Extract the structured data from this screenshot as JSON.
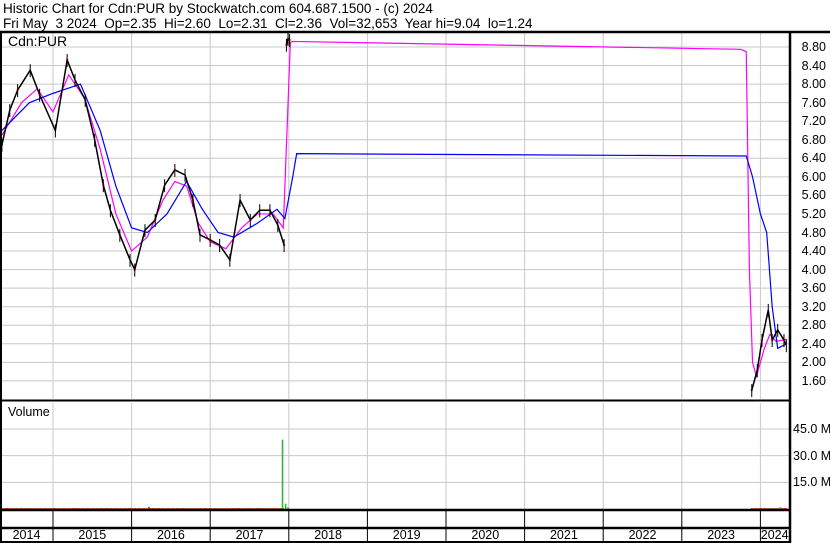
{
  "header": {
    "title": "Historic Chart for Cdn:PUR by Stockwatch.com 604.687.1500 - (c) 2024",
    "quote_line": "Fri May  3 2024  Op=2.35  Hi=2.60  Lo=2.31  Cl=2.36  Vol=32,653  Year hi=9.04  lo=1.24"
  },
  "price_panel": {
    "symbol_label": "Cdn:PUR"
  },
  "volume_panel": {
    "label": "Volume"
  },
  "colors": {
    "price": "#000000",
    "price_dots": "#ff0000",
    "ma_short": "#ff00ff",
    "ma_long": "#0000ff",
    "vol_up": "#3cb043",
    "vol_down": "#ff0000",
    "grid": "#c8c8c8"
  },
  "chart_data": [
    {
      "type": "line",
      "title": "Cdn:PUR",
      "ylim": [
        1.2,
        9.1
      ],
      "y_ticks": [
        "8.80",
        "8.40",
        "8.00",
        "7.60",
        "7.20",
        "6.80",
        "6.40",
        "6.00",
        "5.60",
        "5.20",
        "4.80",
        "4.40",
        "4.00",
        "3.60",
        "3.20",
        "2.80",
        "2.40",
        "2.00",
        "1.60"
      ],
      "x_ticks": [
        "2014",
        "2015",
        "2016",
        "2017",
        "2018",
        "2019",
        "2020",
        "2021",
        "2022",
        "2023",
        "2024"
      ],
      "series": [
        {
          "name": "price",
          "points": [
            [
              2014.35,
              6.69
            ],
            [
              2014.45,
              7.44
            ],
            [
              2014.55,
              7.87
            ],
            [
              2014.71,
              8.3
            ],
            [
              2014.83,
              7.77
            ],
            [
              2015.03,
              7.0
            ],
            [
              2015.18,
              8.52
            ],
            [
              2015.28,
              8.09
            ],
            [
              2015.41,
              7.66
            ],
            [
              2015.53,
              6.8
            ],
            [
              2015.64,
              5.82
            ],
            [
              2015.73,
              5.28
            ],
            [
              2015.85,
              4.75
            ],
            [
              2015.98,
              4.21
            ],
            [
              2016.04,
              4.0
            ],
            [
              2016.17,
              4.85
            ],
            [
              2016.3,
              5.07
            ],
            [
              2016.42,
              5.82
            ],
            [
              2016.55,
              6.15
            ],
            [
              2016.68,
              6.04
            ],
            [
              2016.78,
              5.5
            ],
            [
              2016.87,
              4.75
            ],
            [
              2017.0,
              4.64
            ],
            [
              2017.12,
              4.53
            ],
            [
              2017.25,
              4.21
            ],
            [
              2017.38,
              5.5
            ],
            [
              2017.51,
              5.07
            ],
            [
              2017.63,
              5.28
            ],
            [
              2017.76,
              5.28
            ],
            [
              2017.86,
              4.96
            ],
            [
              2017.94,
              4.53
            ]
          ],
          "segment2": [
            [
              2017.97,
              8.85
            ],
            [
              2017.99,
              8.98
            ],
            [
              2018.01,
              8.95
            ]
          ],
          "segment3": [
            [
              2023.89,
              1.4
            ],
            [
              2023.96,
              1.83
            ],
            [
              2024.02,
              2.48
            ],
            [
              2024.1,
              3.13
            ],
            [
              2024.15,
              2.48
            ],
            [
              2024.22,
              2.7
            ],
            [
              2024.3,
              2.48
            ],
            [
              2024.33,
              2.37
            ]
          ]
        },
        {
          "name": "ma_short",
          "points": [
            [
              2014.35,
              6.9
            ],
            [
              2014.6,
              7.6
            ],
            [
              2014.8,
              7.9
            ],
            [
              2015.0,
              7.4
            ],
            [
              2015.2,
              8.2
            ],
            [
              2015.4,
              7.7
            ],
            [
              2015.6,
              6.6
            ],
            [
              2015.8,
              5.2
            ],
            [
              2016.0,
              4.4
            ],
            [
              2016.2,
              4.7
            ],
            [
              2016.4,
              5.5
            ],
            [
              2016.55,
              5.9
            ],
            [
              2016.7,
              5.8
            ],
            [
              2016.85,
              5.0
            ],
            [
              2017.0,
              4.6
            ],
            [
              2017.2,
              4.45
            ],
            [
              2017.4,
              4.9
            ],
            [
              2017.6,
              5.2
            ],
            [
              2017.8,
              5.2
            ],
            [
              2017.93,
              4.9
            ],
            [
              2018.02,
              8.9
            ],
            [
              2018.05,
              8.92
            ],
            [
              2023.75,
              8.75
            ],
            [
              2023.82,
              8.7
            ],
            [
              2023.86,
              4.0
            ],
            [
              2023.9,
              2.0
            ],
            [
              2023.95,
              1.7
            ],
            [
              2024.05,
              2.3
            ],
            [
              2024.12,
              2.6
            ],
            [
              2024.2,
              2.45
            ],
            [
              2024.33,
              2.5
            ]
          ]
        },
        {
          "name": "ma_long",
          "points": [
            [
              2014.35,
              7.0
            ],
            [
              2014.7,
              7.6
            ],
            [
              2015.0,
              7.8
            ],
            [
              2015.35,
              8.0
            ],
            [
              2015.6,
              7.0
            ],
            [
              2015.8,
              5.8
            ],
            [
              2016.0,
              4.9
            ],
            [
              2016.2,
              4.8
            ],
            [
              2016.45,
              5.2
            ],
            [
              2016.7,
              5.9
            ],
            [
              2016.9,
              5.3
            ],
            [
              2017.1,
              4.8
            ],
            [
              2017.3,
              4.7
            ],
            [
              2017.6,
              5.0
            ],
            [
              2017.85,
              5.3
            ],
            [
              2017.95,
              5.1
            ],
            [
              2018.05,
              6.0
            ],
            [
              2018.1,
              6.5
            ],
            [
              2023.82,
              6.45
            ],
            [
              2023.9,
              6.0
            ],
            [
              2024.0,
              5.2
            ],
            [
              2024.08,
              4.8
            ],
            [
              2024.15,
              3.2
            ],
            [
              2024.22,
              2.3
            ],
            [
              2024.33,
              2.4
            ]
          ]
        }
      ]
    },
    {
      "type": "bar",
      "title": "Volume",
      "ylim": [
        0,
        50
      ],
      "y_ticks": [
        "45.0 M",
        "30.0 M",
        "15.0 M"
      ],
      "y_tick_values": [
        45,
        30,
        15
      ],
      "baseline_ranges": [
        [
          2014.35,
          2017.93,
          0.5
        ],
        [
          2023.89,
          2024.33,
          0.5
        ]
      ],
      "bars": [
        [
          2017.92,
          39,
          "up"
        ],
        [
          2017.96,
          3,
          "up"
        ],
        [
          2017.99,
          1,
          "up"
        ],
        [
          2016.22,
          1.2,
          "down"
        ],
        [
          2024.25,
          1,
          "up"
        ]
      ]
    }
  ]
}
